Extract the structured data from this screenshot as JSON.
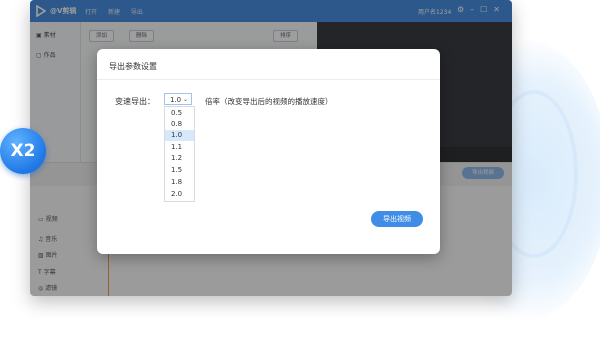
{
  "app": {
    "name": "@V剪辑",
    "menu": [
      "打开",
      "新建",
      "导出"
    ],
    "user": "用户名1234",
    "window_buttons": [
      "minimize-icon",
      "restore-icon",
      "close-icon"
    ]
  },
  "leftnav": {
    "items": [
      "素材",
      "作品"
    ]
  },
  "toolbar": {
    "add": "添加",
    "delete": "删除",
    "view": "排序"
  },
  "timeline": {
    "export_small": "导出视频",
    "tracks": [
      "视频",
      "音乐",
      "图片",
      "字幕",
      "滤镜"
    ]
  },
  "badge": {
    "text": "X2"
  },
  "dialog": {
    "title": "导出参数设置",
    "speed_label": "变速导出：",
    "speed_value": "1.0",
    "hint": "倍率（改变导出后的视频的播放速度）",
    "options": [
      "0.5",
      "0.8",
      "1.0",
      "1.1",
      "1.2",
      "1.5",
      "1.8",
      "2.0"
    ],
    "selected_option": "1.0",
    "export_button": "导出视频"
  }
}
